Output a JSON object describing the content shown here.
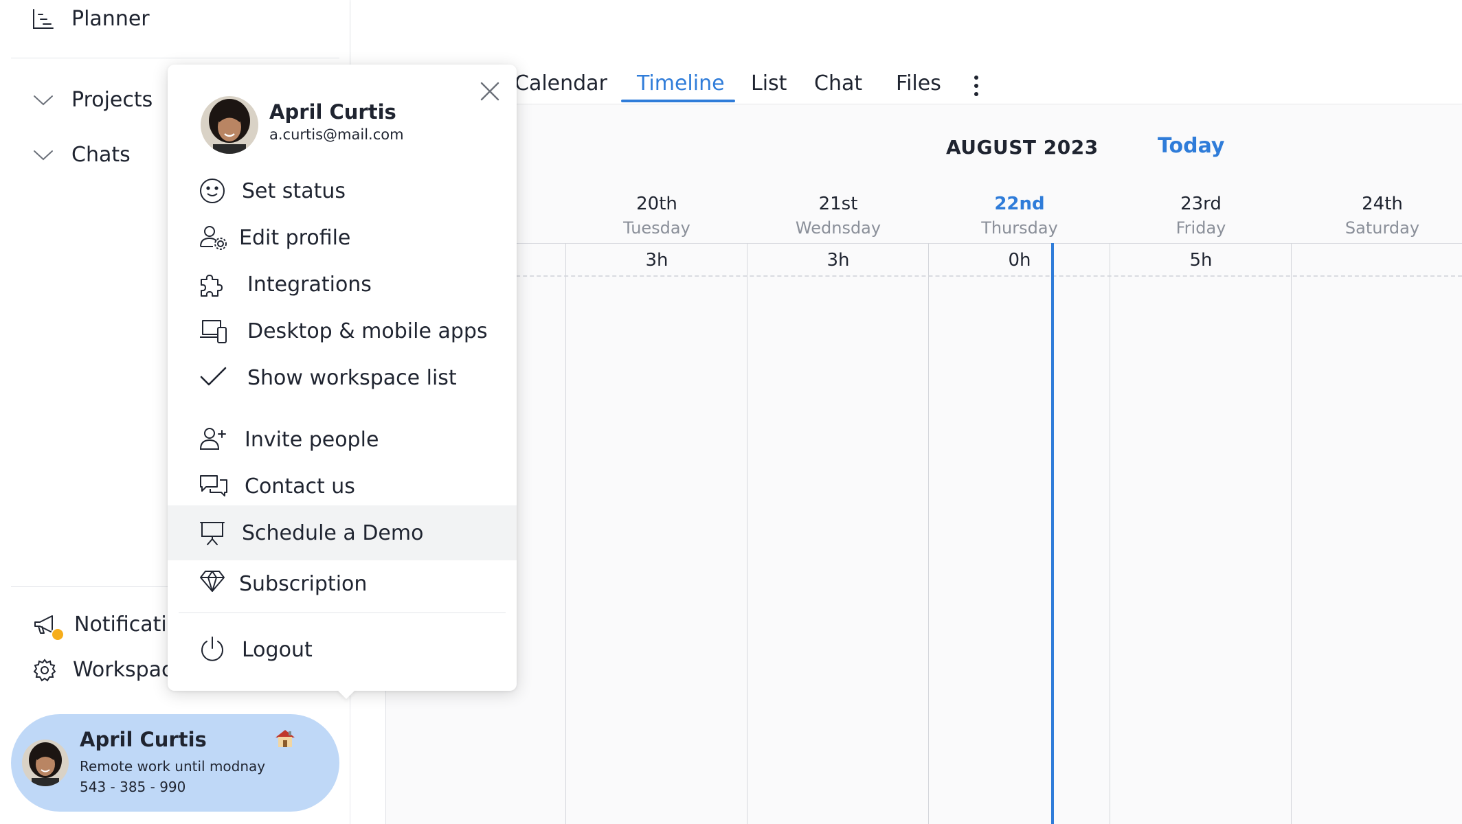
{
  "sidebar": {
    "planner_label": "Planner",
    "projects_label": "Projects",
    "chats_label": "Chats",
    "notifications_label": "Notifications",
    "workspace_label": "Workspace settings",
    "user_card": {
      "name": "April Curtis",
      "status": "Remote work until modnay",
      "phone": "543 - 385 - 990",
      "status_emoji_icon": "house-icon"
    }
  },
  "tabs": [
    {
      "label": "Calendar",
      "active": false
    },
    {
      "label": "Timeline",
      "active": true
    },
    {
      "label": "List",
      "active": false
    },
    {
      "label": "Chat",
      "active": false
    },
    {
      "label": "Files",
      "active": false
    }
  ],
  "calendar": {
    "month": "AUGUST 2023",
    "today_label": "Today",
    "days": [
      {
        "date": "20th",
        "weekday": "Tuesday",
        "hours": "3h",
        "current": false
      },
      {
        "date": "21st",
        "weekday": "Wednsday",
        "hours": "3h",
        "current": false
      },
      {
        "date": "22nd",
        "weekday": "Thursday",
        "hours": "0h",
        "current": true
      },
      {
        "date": "23rd",
        "weekday": "Friday",
        "hours": "5h",
        "current": false
      },
      {
        "date": "24th",
        "weekday": "Saturday",
        "hours": "",
        "current": false
      }
    ]
  },
  "profile_menu": {
    "name": "April Curtis",
    "email": "a.curtis@mail.com",
    "items": [
      {
        "label": "Set status",
        "icon": "smiley-icon"
      },
      {
        "label": "Edit profile",
        "icon": "user-gear-icon"
      },
      {
        "label": "Integrations",
        "icon": "puzzle-icon"
      },
      {
        "label": "Desktop & mobile apps",
        "icon": "devices-icon"
      },
      {
        "label": "Show workspace list",
        "icon": "check-icon"
      },
      {
        "label": "Invite people",
        "icon": "user-plus-icon"
      },
      {
        "label": "Contact us",
        "icon": "chat-bubbles-icon"
      },
      {
        "label": "Schedule a Demo",
        "icon": "presentation-icon"
      },
      {
        "label": "Subscription",
        "icon": "diamond-icon"
      },
      {
        "label": "Logout",
        "icon": "power-icon"
      }
    ]
  },
  "colors": {
    "accent": "#2f7cd9",
    "user_card_bg": "#bfd8f7",
    "notification_dot": "#f6ad1b",
    "hover_bg": "#f2f3f4"
  }
}
